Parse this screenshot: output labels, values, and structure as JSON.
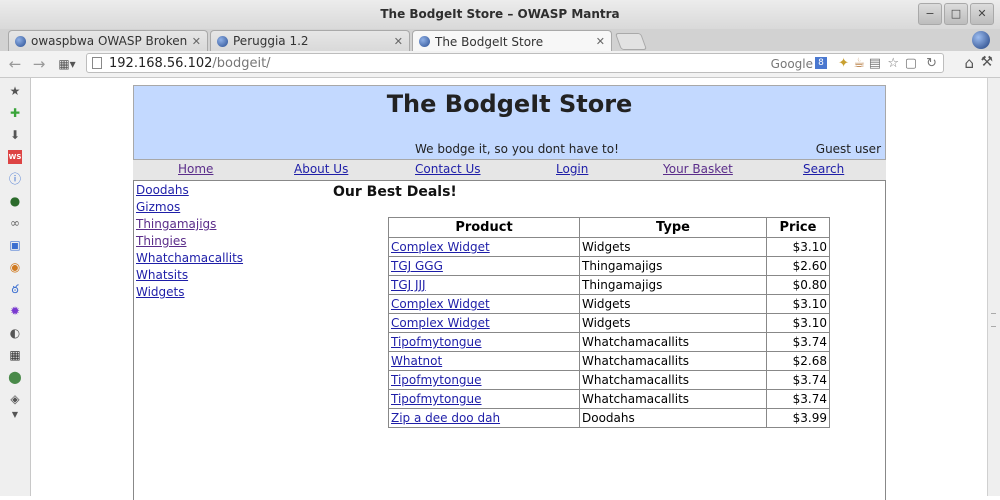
{
  "window": {
    "title": "The BodgeIt Store – OWASP Mantra",
    "buttons": [
      "−",
      "□",
      "✕"
    ]
  },
  "tabs": [
    {
      "label": "owaspbwa OWASP Broken ...",
      "active": false
    },
    {
      "label": "Peruggia 1.2",
      "active": false
    },
    {
      "label": "The BodgeIt Store",
      "active": true
    }
  ],
  "tab_close": "✕",
  "toolbar": {
    "back": "←",
    "forward": "→",
    "menu": "▦▾",
    "url_host": "192.168.56.102",
    "url_path": "/bodgeit/",
    "search_engine": "Google",
    "search_badge": "8",
    "home": "⌂",
    "wrench": "⚒"
  },
  "sidebar_icons": [
    "star-icon",
    "puzzle-icon",
    "download-icon",
    "ws-icon",
    "info-icon",
    "ladybug-icon",
    "glasses-icon",
    "monitor-icon",
    "monster-icon",
    "swirl-icon",
    "gear-icon",
    "palette-icon",
    "grid-icon",
    "balloon-icon",
    "tag-icon"
  ],
  "site": {
    "title": "The BodgeIt Store",
    "tagline": "We bodge it, so you dont have to!",
    "user": "Guest user",
    "menu": [
      {
        "label": "Home",
        "visited": true
      },
      {
        "label": "About Us",
        "visited": false
      },
      {
        "label": "Contact Us",
        "visited": false
      },
      {
        "label": "Login",
        "visited": false
      },
      {
        "label": "Your Basket",
        "visited": true
      },
      {
        "label": "Search",
        "visited": false
      }
    ],
    "categories": [
      {
        "label": "Doodahs",
        "visited": false
      },
      {
        "label": "Gizmos",
        "visited": false
      },
      {
        "label": "Thingamajigs",
        "visited": true
      },
      {
        "label": "Thingies",
        "visited": true
      },
      {
        "label": "Whatchamacallits",
        "visited": false
      },
      {
        "label": "Whatsits",
        "visited": false
      },
      {
        "label": "Widgets",
        "visited": false
      }
    ],
    "deals_heading": "Our Best Deals!",
    "table": {
      "headers": [
        "Product",
        "Type",
        "Price"
      ],
      "rows": [
        [
          "Complex Widget",
          "Widgets",
          "$3.10"
        ],
        [
          "TGJ GGG",
          "Thingamajigs",
          "$2.60"
        ],
        [
          "TGJ JJJ",
          "Thingamajigs",
          "$0.80"
        ],
        [
          "Complex Widget",
          "Widgets",
          "$3.10"
        ],
        [
          "Complex Widget",
          "Widgets",
          "$3.10"
        ],
        [
          "Tipofmytongue",
          "Whatchamacallits",
          "$3.74"
        ],
        [
          "Whatnot",
          "Whatchamacallits",
          "$2.68"
        ],
        [
          "Tipofmytongue",
          "Whatchamacallits",
          "$3.74"
        ],
        [
          "Tipofmytongue",
          "Whatchamacallits",
          "$3.74"
        ],
        [
          "Zip a dee doo dah",
          "Doodahs",
          "$3.99"
        ]
      ]
    }
  },
  "colors": {
    "header_bg": "#c3d9ff",
    "menu_bg": "#e6e6e6",
    "link": "#1e1ea8",
    "visited": "#5b2d8a"
  }
}
